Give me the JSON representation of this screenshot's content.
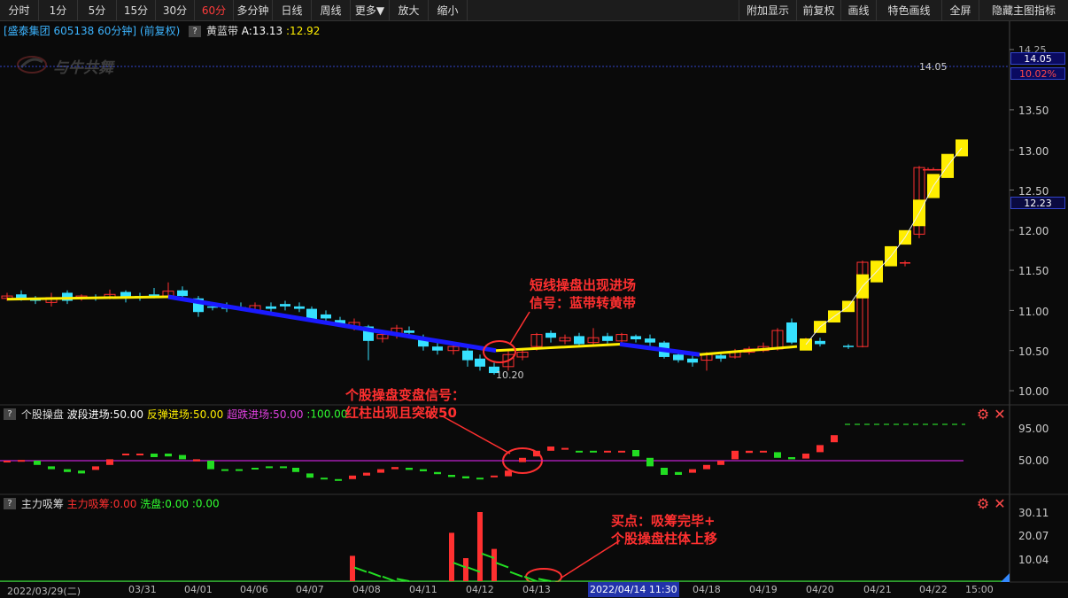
{
  "toolbar": {
    "buttons": [
      "分时",
      "1分",
      "5分",
      "15分",
      "30分",
      "60分",
      "多分钟",
      "日线",
      "周线",
      "更多▼",
      "放大",
      "缩小"
    ],
    "active_index": 5,
    "right_buttons": [
      "附加显示",
      "前复权",
      "画线",
      "特色画线",
      "全屏",
      "隐藏主图指标"
    ]
  },
  "header": {
    "stock": "[盛泰集团 605138 60分钟]",
    "adjust": "(前复权)",
    "indicator_name": "黄蓝带",
    "indicator_a": "A:13.13",
    "indicator_b": ":12.92",
    "help": "?"
  },
  "watermark": "与牛共舞",
  "price_axis": {
    "ticks": [
      "14.25",
      "14.05",
      "13.50",
      "13.00",
      "12.50",
      "12.00",
      "11.50",
      "11.00",
      "10.50",
      "10.00"
    ],
    "current_price": "14.05",
    "current_pct": "10.02%",
    "cursor_price": "12.23",
    "low_mark": "10.20",
    "high_mark": "14.05"
  },
  "panel2": {
    "title": "个股操盘",
    "wave": "波段进场:50.00",
    "rebound": "反弹进场:50.00",
    "oversold": "超跌进场:50.00",
    "val4": ":100.00",
    "ticks": [
      "95.00",
      "50.00"
    ]
  },
  "panel3": {
    "title": "主力吸筹",
    "absorb": "主力吸筹:0.00",
    "wash": "洗盘:0.00",
    "val3": ":0.00",
    "ticks": [
      "30.11",
      "20.07",
      "10.04"
    ]
  },
  "dates": [
    "2022/03/29(二)",
    "03/31",
    "04/01",
    "04/06",
    "04/07",
    "04/08",
    "04/11",
    "04/12",
    "04/13",
    "04/18",
    "04/19",
    "04/20",
    "04/21",
    "04/22",
    "15:00"
  ],
  "date_cursor": "2022/04/14 11:30",
  "annotations": {
    "a1_line1": "短线操盘出现进场",
    "a1_line2": "信号：蓝带转黄带",
    "a2_line1": "个股操盘变盘信号：",
    "a2_line2": "红柱出现且突破50",
    "a3_line1": "买点：吸筹完毕+",
    "a3_line2": "个股操盘柱体上移"
  },
  "colors": {
    "up": "#ff3030",
    "down": "#36e0ff",
    "yellow_band": "#ffee00",
    "blue_band": "#1a1aff",
    "magenta_line": "#c020d0"
  }
}
